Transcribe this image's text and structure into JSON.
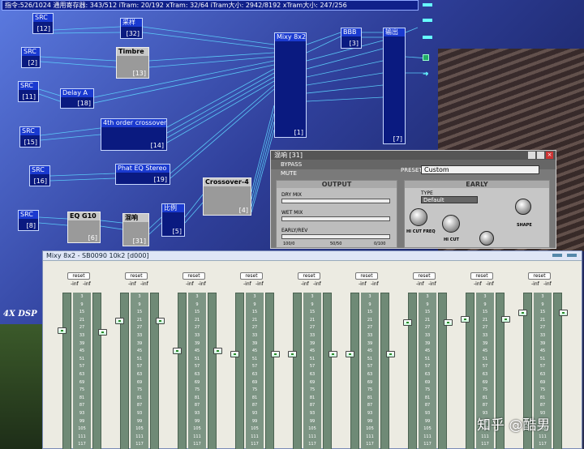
{
  "status": "指令:526/1024 通用寄存器: 343/512 iTram: 20/192 xTram: 32/64 iTram大小: 2942/8192 xTram大小: 247/256",
  "nodes": {
    "src1": {
      "title": "SRC",
      "idx": "[12]"
    },
    "src2": {
      "title": "SRC",
      "idx": "[2]"
    },
    "src3": {
      "title": "SRC",
      "idx": "[11]"
    },
    "src4": {
      "title": "SRC",
      "idx": "[15]"
    },
    "src5": {
      "title": "SRC",
      "idx": "[16]"
    },
    "src6": {
      "title": "SRC",
      "idx": "[8]"
    },
    "mix1": {
      "title": "采样",
      "idx": "[32]"
    },
    "timbre": {
      "title": "Timbre",
      "idx": "[13]"
    },
    "delay": {
      "title": "Delay A",
      "idx": "[18]"
    },
    "crossover4th": {
      "title": "4th order crossover",
      "idx": "[14]"
    },
    "phateq": {
      "title": "Phat EQ Stereo",
      "idx": "[19]"
    },
    "eqg10": {
      "title": "EQ G10",
      "idx": "[6]"
    },
    "reverbnode": {
      "title": "混响",
      "idx": "[31]"
    },
    "ratio": {
      "title": "比例",
      "idx": "[5]"
    },
    "crossover4": {
      "title": "Crossover-4",
      "idx": "[4]"
    },
    "mixy": {
      "title": "Mixy 8x2",
      "idx": "[1]"
    },
    "bbb": {
      "title": "BBB",
      "idx": "[3]"
    },
    "output": {
      "title": "输出",
      "idx": "[7]"
    }
  },
  "dsp_label": "4X DSP",
  "reverb": {
    "title": "混响 [31]",
    "bypass": "BYPASS",
    "mute": "MUTE",
    "preset_label": "PRESET",
    "preset_value": "Custom",
    "output_label": "OUTPUT",
    "early_label": "EARLY",
    "dry_mix": "DRY MIX",
    "wet_mix": "WET MIX",
    "early_rev": "EARLY/REV",
    "scale_left": "100/0",
    "scale_mid": "50/50",
    "scale_right": "0/100",
    "type_label": "TYPE",
    "type_value": "Default",
    "hi_cut_freq": "HI CUT FREQ",
    "hi_cut": "HI CUT",
    "shape": "SHAPE"
  },
  "mixer": {
    "title": "Mixy 8x2 - SB0090 10k2 [d000]",
    "reset_label": "reset",
    "inf_label": "-inf",
    "ticks": [
      "3",
      "9",
      "15",
      "21",
      "27",
      "33",
      "39",
      "45",
      "51",
      "57",
      "63",
      "69",
      "75",
      "81",
      "87",
      "93",
      "99",
      "105",
      "111",
      "117"
    ],
    "fader_levels": [
      {
        "left": 0.22,
        "right": 0.23
      },
      {
        "left": 0.16,
        "right": 0.16
      },
      {
        "left": 0.35,
        "right": 0.35
      },
      {
        "left": 0.37,
        "right": 0.37
      },
      {
        "left": 0.37,
        "right": 0.37
      },
      {
        "left": 0.37,
        "right": 0.37
      },
      {
        "left": 0.17,
        "right": 0.17
      },
      {
        "left": 0.15,
        "right": 0.15
      },
      {
        "left": 0.11,
        "right": 0.11
      }
    ]
  },
  "watermark": "知乎 @酷男"
}
